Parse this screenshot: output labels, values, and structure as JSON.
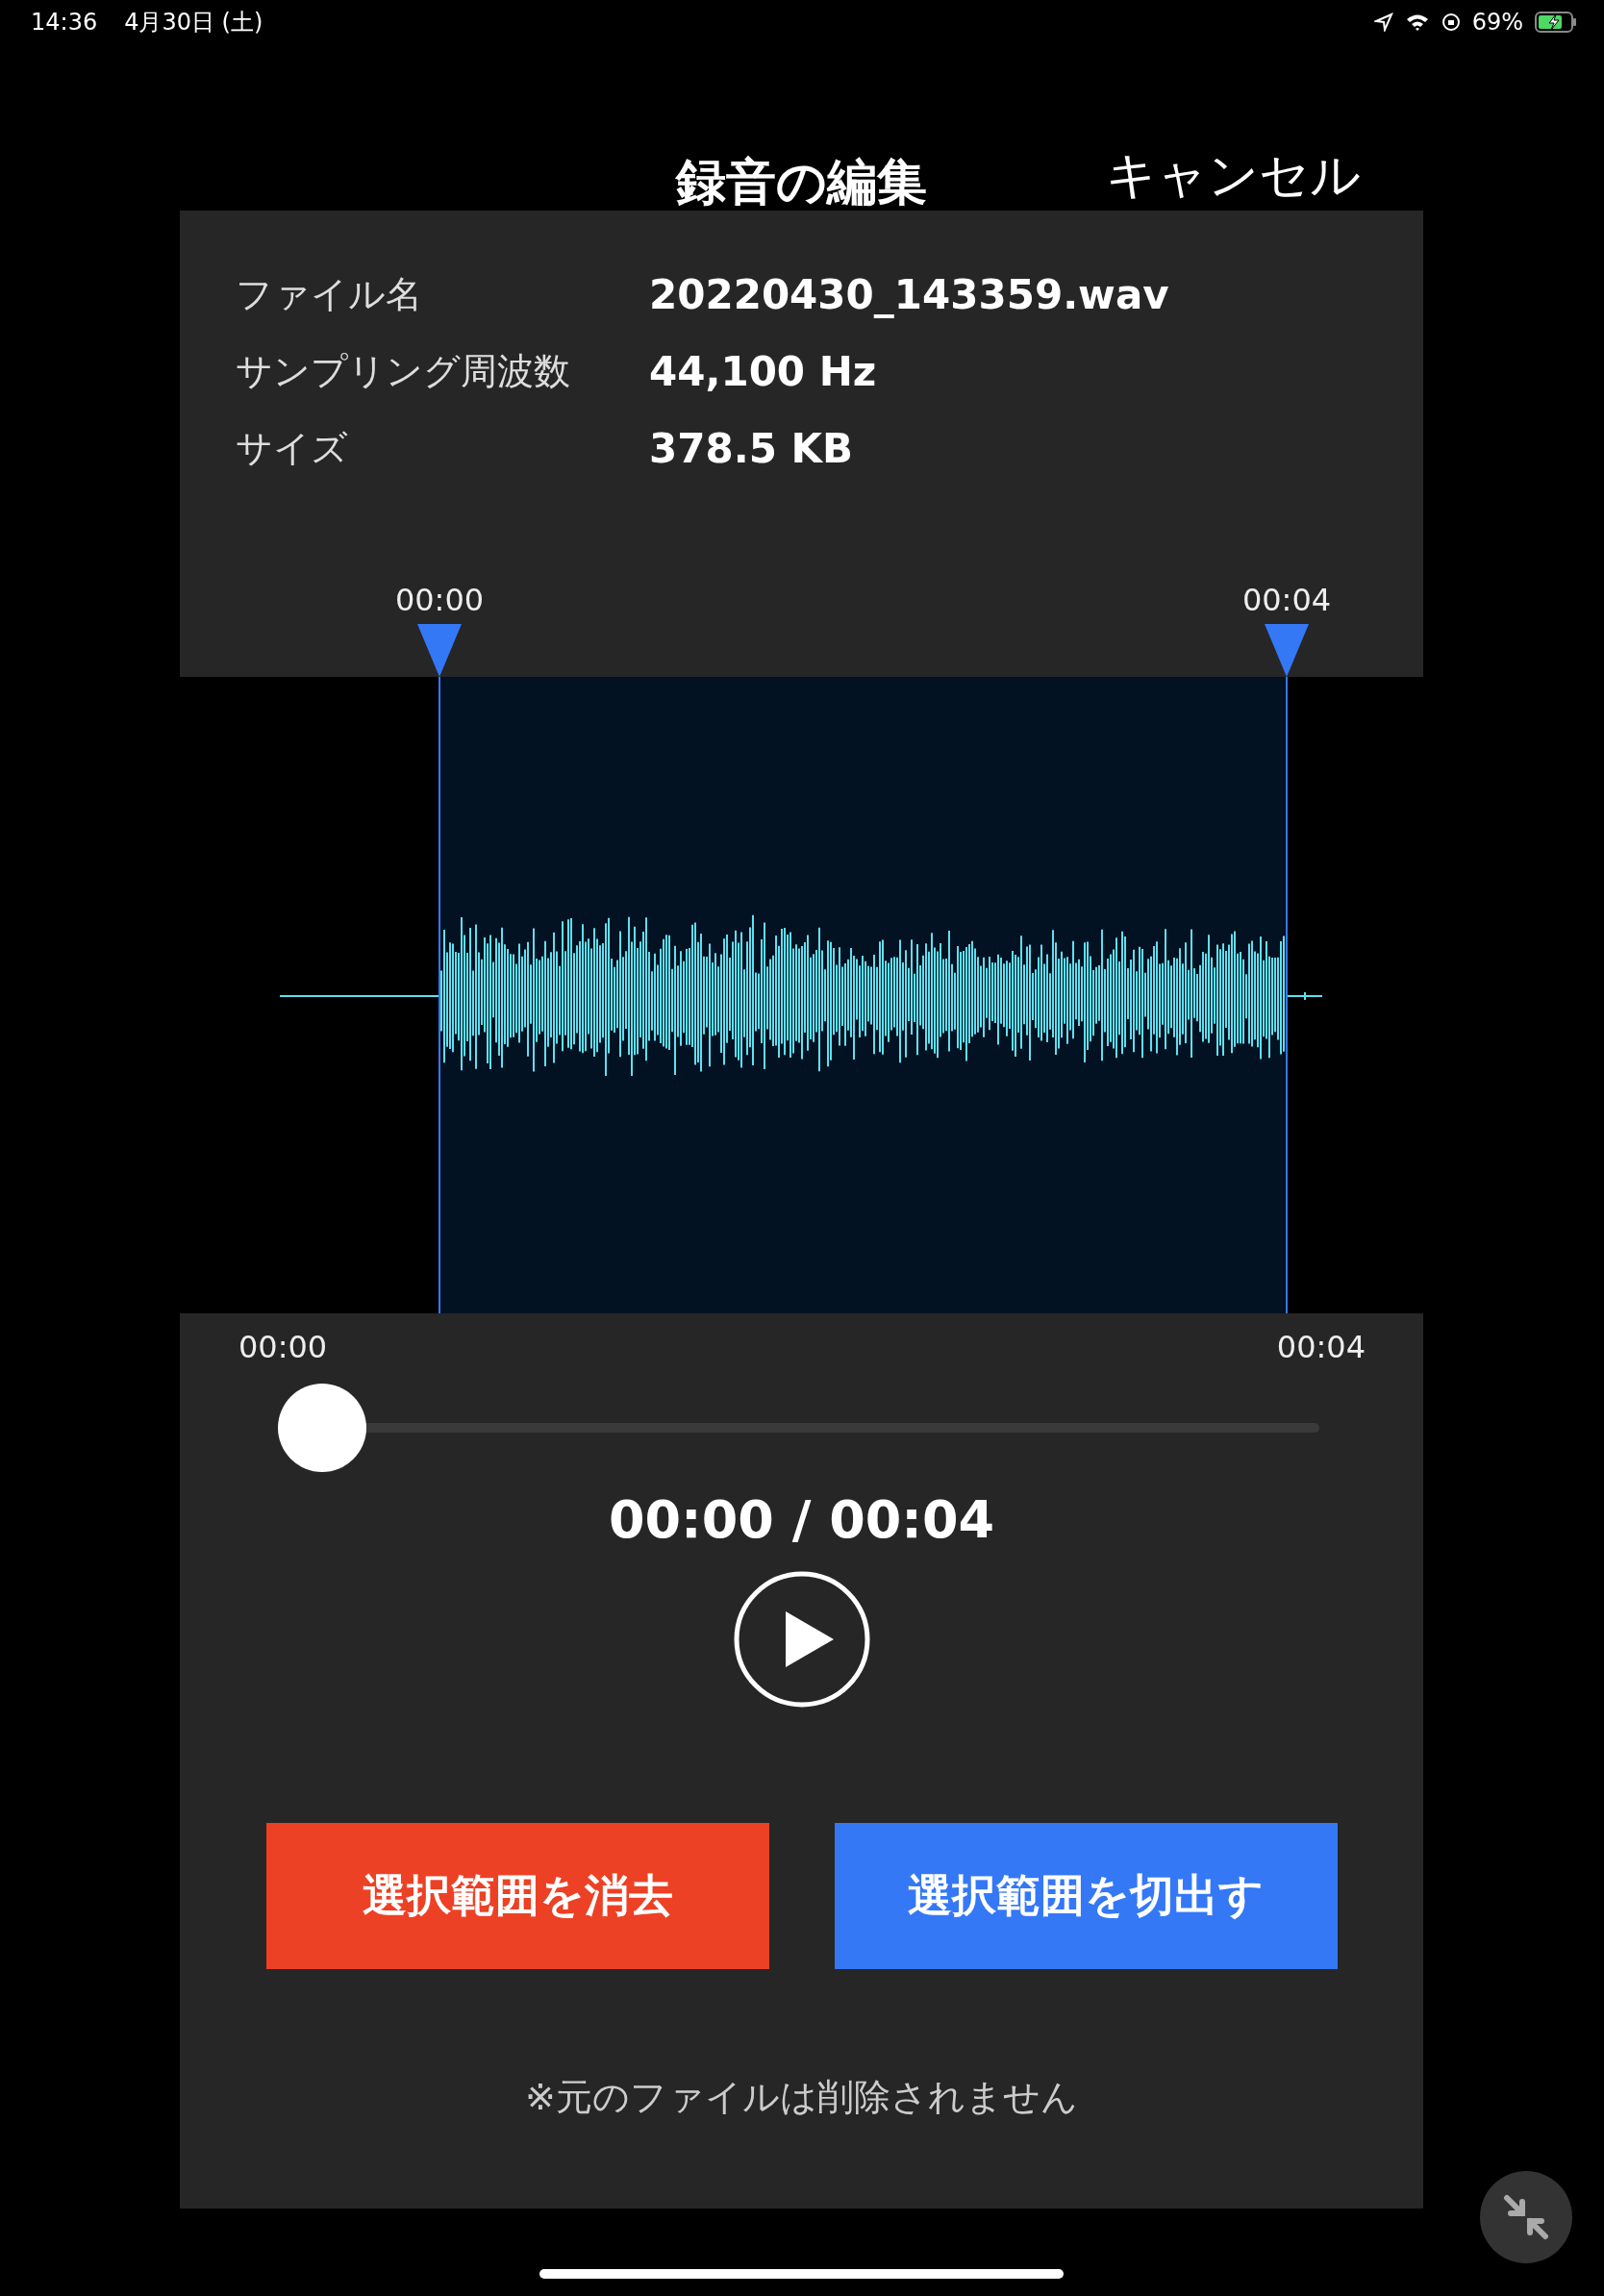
{
  "status_bar": {
    "time": "14:36",
    "date": "4月30日 (土)",
    "battery": "69%"
  },
  "header": {
    "title": "録音の編集",
    "cancel": "キャンセル"
  },
  "file_info": [
    {
      "label": "ファイル名",
      "value": "20220430_143359.wav"
    },
    {
      "label": "サンプリング周波数",
      "value": "44,100 Hz"
    },
    {
      "label": "サイズ",
      "value": "378.5 KB"
    }
  ],
  "selection": {
    "start": "00:00",
    "end": "00:04"
  },
  "timeline": {
    "start": "00:00",
    "end": "00:04"
  },
  "playback": {
    "level": 0,
    "time": "00:00 / 00:04"
  },
  "buttons": [
    {
      "label": "選択範囲を消去",
      "kind": "delete"
    },
    {
      "label": "選択範囲を切出す",
      "kind": "trim"
    }
  ],
  "note": "※元のファイルは削除されません"
}
